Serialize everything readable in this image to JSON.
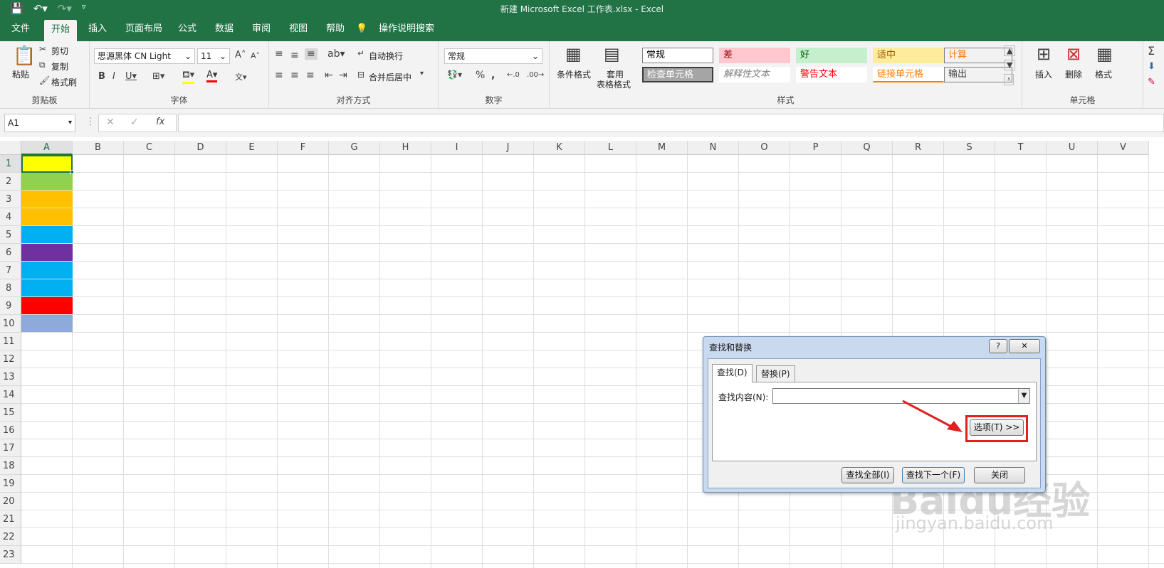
{
  "window": {
    "title": "新建 Microsoft Excel 工作表.xlsx  -  Excel"
  },
  "menu": {
    "items": [
      "文件",
      "开始",
      "插入",
      "页面布局",
      "公式",
      "数据",
      "审阅",
      "视图",
      "帮助",
      "操作说明搜索"
    ],
    "active": "开始"
  },
  "ribbon": {
    "clipboard": {
      "paste": "粘贴",
      "cut": "剪切",
      "copy": "复制",
      "format_painter": "格式刷",
      "label": "剪贴板"
    },
    "font": {
      "name": "思源黑体 CN Light",
      "size": "11",
      "label": "字体"
    },
    "alignment": {
      "wrap": "自动换行",
      "merge": "合并后居中",
      "label": "对齐方式"
    },
    "number": {
      "format": "常规",
      "label": "数字"
    },
    "styles": {
      "conditional": "条件格式",
      "table_a": "套用",
      "table_b": "表格格式",
      "label": "样式",
      "cells": [
        {
          "text": "常规",
          "bg": "#ffffff",
          "color": "#000000"
        },
        {
          "text": "差",
          "bg": "#ffc7ce",
          "color": "#9c0006"
        },
        {
          "text": "好",
          "bg": "#c6efce",
          "color": "#006100"
        },
        {
          "text": "适中",
          "bg": "#ffeb9c",
          "color": "#9c5700"
        },
        {
          "text": "计算",
          "bg": "#f2f2f2",
          "color": "#fa7d00"
        },
        {
          "text": "检查单元格",
          "bg": "#a5a5a5",
          "color": "#ffffff"
        },
        {
          "text": "解释性文本",
          "bg": "#ffffff",
          "color": "#7f7f7f"
        },
        {
          "text": "警告文本",
          "bg": "#ffffff",
          "color": "#ff0000"
        },
        {
          "text": "链接单元格",
          "bg": "#ffffff",
          "color": "#fa7d00"
        },
        {
          "text": "输出",
          "bg": "#f2f2f2",
          "color": "#3f3f3f"
        }
      ]
    },
    "cells": {
      "insert": "插入",
      "delete": "删除",
      "format": "格式",
      "label": "单元格"
    }
  },
  "formula_bar": {
    "name_box": "A1",
    "fx": "fx"
  },
  "sheet": {
    "columns": [
      "A",
      "B",
      "C",
      "D",
      "E",
      "F",
      "G",
      "H",
      "I",
      "J",
      "K",
      "L",
      "M",
      "N",
      "O",
      "P",
      "Q",
      "R",
      "S",
      "T",
      "U",
      "V"
    ],
    "rows": [
      "1",
      "2",
      "3",
      "4",
      "5",
      "6",
      "7",
      "8",
      "9",
      "10",
      "11",
      "12",
      "13",
      "14",
      "15",
      "16",
      "17",
      "18",
      "19",
      "20",
      "21",
      "22",
      "23"
    ],
    "fills": [
      "#ffff00",
      "#92d050",
      "#ffc000",
      "#ffc000",
      "#00b0f0",
      "#7030a0",
      "#00b0f0",
      "#00b0f0",
      "#ff0000",
      "#8eaadb"
    ]
  },
  "dialog": {
    "title": "查找和替换",
    "help": "?",
    "close_x": "✕",
    "tab_find": "查找(D)",
    "tab_replace": "替换(P)",
    "find_label": "查找内容(N):",
    "find_value": "",
    "options": "选项(T) >>",
    "find_all": "查找全部(I)",
    "find_next": "查找下一个(F)",
    "close": "关闭"
  },
  "watermark": {
    "logo": "Baidu经验",
    "url": "jingyan.baidu.com"
  }
}
